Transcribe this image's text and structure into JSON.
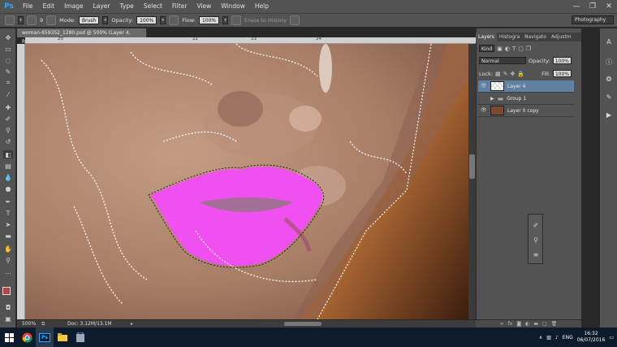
{
  "app": {
    "logo": "Ps"
  },
  "menu": [
    "File",
    "Edit",
    "Image",
    "Layer",
    "Type",
    "Select",
    "Filter",
    "View",
    "Window",
    "Help"
  ],
  "window_controls": [
    "—",
    "❐",
    "✕"
  ],
  "options_bar": {
    "mode_label": "Mode:",
    "mode_value": "Brush",
    "opacity_label": "Opacity:",
    "opacity_value": "100%",
    "flow_label": "Flow:",
    "flow_value": "100%",
    "erase_history": "Erase to History",
    "brush_size": "9"
  },
  "workspace": "Photography",
  "document": {
    "tab_title": "woman-659352_1280.psd @ 500% (Layer 4, RGB/8#) *",
    "ruler_marks": [
      "20",
      "22",
      "23",
      "24"
    ],
    "zoom": "500%",
    "doc_info": "Doc: 3.12M/13.1M"
  },
  "layers_panel": {
    "tabs": [
      "Layers",
      "Histogra",
      "Navigato",
      "Adjustm"
    ],
    "kind": "Kind",
    "blend_mode": "Normal",
    "opacity_label": "Opacity:",
    "opacity_value": "100%",
    "lock_label": "Lock:",
    "fill_label": "Fill:",
    "fill_value": "100%",
    "layers": [
      {
        "name": "Layer 4",
        "selected": true
      },
      {
        "name": "Group 1",
        "selected": false
      },
      {
        "name": "Layer 0 copy",
        "selected": false
      }
    ]
  },
  "taskbar": {
    "language": "ENG",
    "time": "16:32",
    "date": "06/07/2016"
  },
  "colors": {
    "lip_overlay": "#f050f0",
    "selection_accent": "#5f7fa3",
    "taskbar": "#0d1b2a"
  }
}
